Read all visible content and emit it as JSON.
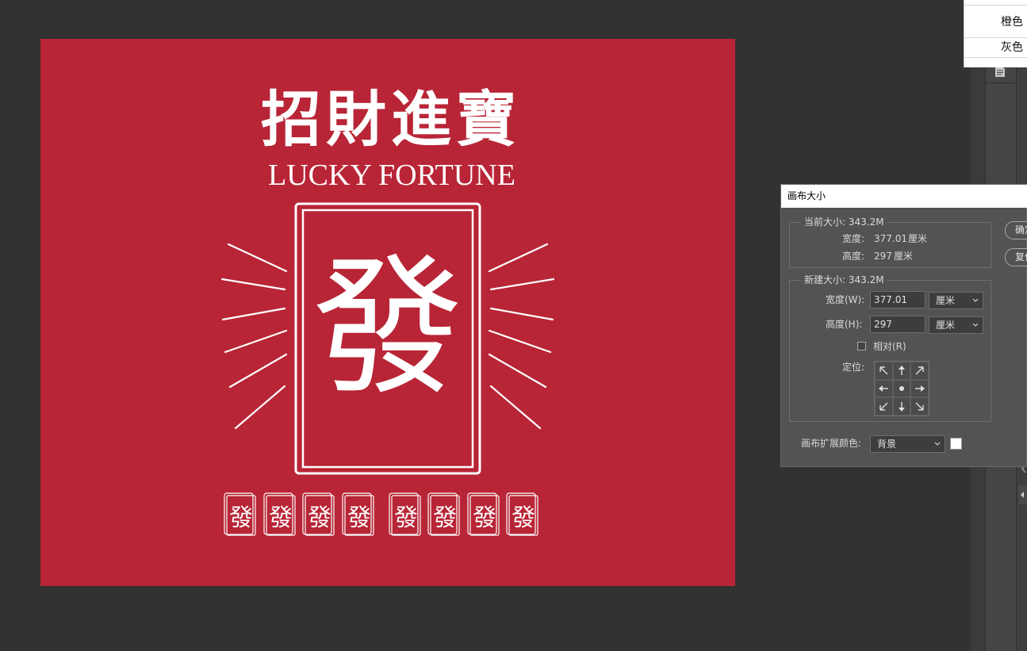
{
  "color_menu": {
    "items": [
      "橙色",
      "灰色"
    ]
  },
  "poster": {
    "title_cn": "招財進寶",
    "title_en": "LUCKY FORTUNE",
    "center_glyph": "發",
    "tile_glyph": "發",
    "tile_count": 8,
    "background_color": "#b82536",
    "foreground_color": "#ffffff"
  },
  "dialog": {
    "title": "画布大小",
    "current_size": {
      "legend": "当前大小: 343.2M",
      "width_label": "宽度:",
      "width_value": "377.01",
      "width_unit": "厘米",
      "height_label": "高度:",
      "height_value": "297",
      "height_unit": "厘米"
    },
    "new_size": {
      "legend": "新建大小: 343.2M",
      "width_label": "宽度(W):",
      "width_value": "377.01",
      "width_unit": "厘米",
      "height_label": "高度(H):",
      "height_value": "297",
      "height_unit": "厘米",
      "relative_label": "相对(R)",
      "relative_checked": false,
      "anchor_label": "定位:"
    },
    "extension_color_label": "画布扩展颜色:",
    "extension_color_value": "背景",
    "extension_swatch_color": "#ffffff",
    "ok_button": "确定",
    "reset_button": "复位"
  }
}
